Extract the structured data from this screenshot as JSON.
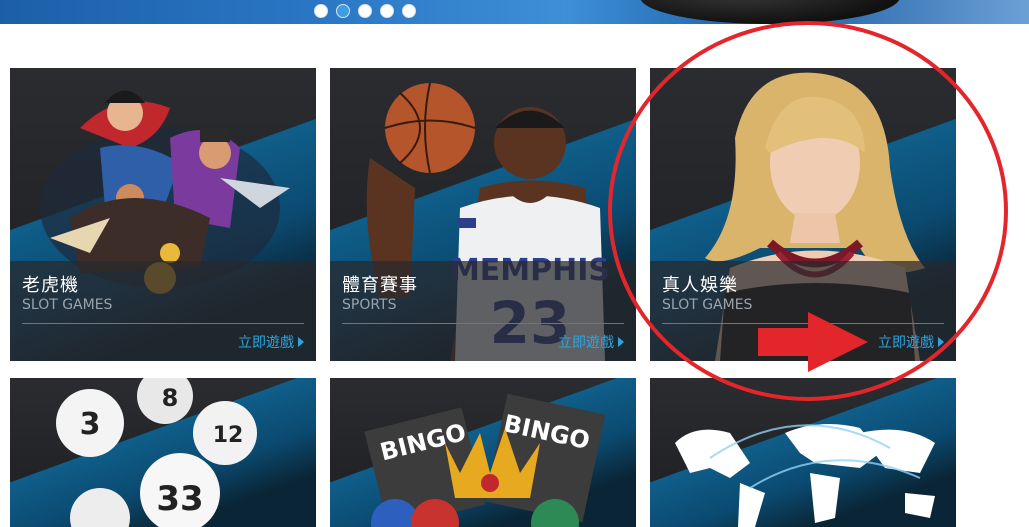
{
  "banner": {
    "dots": 5,
    "active_dot": 1
  },
  "cards": [
    {
      "title": "老虎機",
      "subtitle": "SLOT GAMES",
      "play": "立即遊戲"
    },
    {
      "title": "體育賽事",
      "subtitle": "SPORTS",
      "play": "立即遊戲"
    },
    {
      "title": "真人娛樂",
      "subtitle": "SLOT GAMES",
      "play": "立即遊戲"
    }
  ],
  "art": {
    "sports_jersey": "MEMPHIS",
    "sports_number": "23",
    "lottery_balls": [
      "3",
      "8",
      "12",
      "33"
    ],
    "bingo_cards": [
      "BINGO",
      "BINGO"
    ]
  },
  "colors": {
    "accent": "#2ba4e0",
    "annotation": "#e3262b",
    "panel": "#1d1f22",
    "stripe": "#0f5e8a"
  }
}
